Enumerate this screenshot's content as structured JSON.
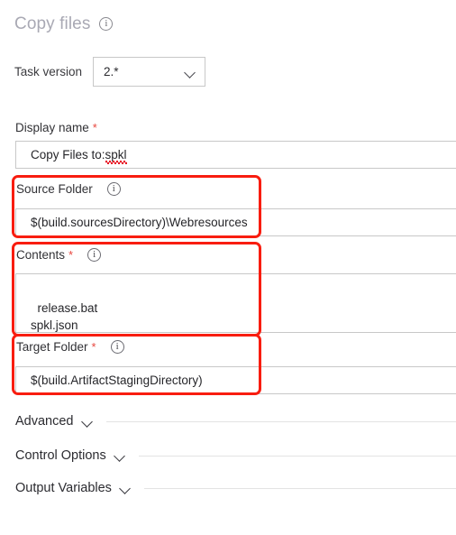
{
  "header": {
    "title": "Copy files",
    "info_icon": "info-icon"
  },
  "task_version": {
    "label": "Task version",
    "value": "2.*",
    "chevron_icon": "chevron-down-icon"
  },
  "fields": {
    "display_name": {
      "label": "Display name",
      "required": true,
      "required_marker": "*",
      "value_prefix": "Copy Files to: ",
      "value_misspelled": "spkl",
      "value": "Copy Files to: spkl"
    },
    "source_folder": {
      "label": "Source Folder",
      "required": false,
      "info_icon": "info-icon",
      "value": "$(build.sourcesDirectory)\\Webresources"
    },
    "contents": {
      "label": "Contents",
      "required": true,
      "required_marker": "*",
      "info_icon": "info-icon",
      "value": "release.bat\nspkl.json"
    },
    "target_folder": {
      "label": "Target Folder",
      "required": true,
      "required_marker": "*",
      "info_icon": "info-icon",
      "value": "$(build.ArtifactStagingDirectory)"
    }
  },
  "sections": [
    {
      "label": "Advanced",
      "chevron_icon": "chevron-down-icon"
    },
    {
      "label": "Control Options",
      "chevron_icon": "chevron-down-icon"
    },
    {
      "label": "Output Variables",
      "chevron_icon": "chevron-down-icon"
    }
  ],
  "annotations": {
    "highlight_color": "#f81d10",
    "boxes": [
      "source-folder",
      "contents",
      "target-folder"
    ]
  }
}
